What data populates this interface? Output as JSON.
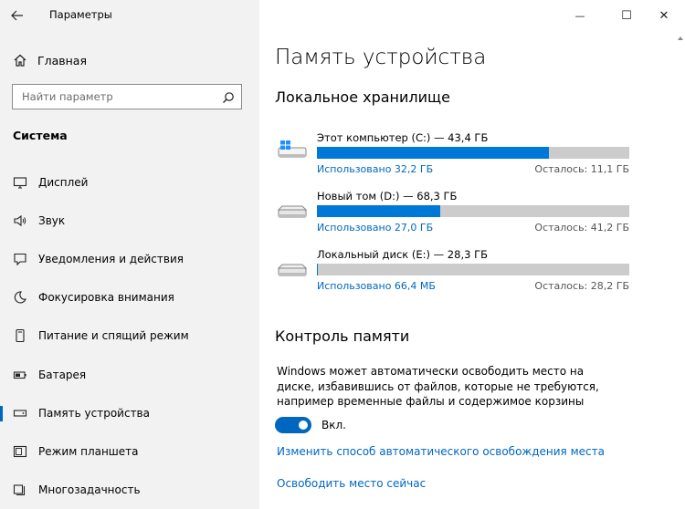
{
  "window": {
    "title": "Параметры",
    "minimize_glyph": "—",
    "maximize_glyph": "☐",
    "close_glyph": "✕"
  },
  "sidebar": {
    "home_label": "Главная",
    "search_placeholder": "Найти параметр",
    "section_title": "Система",
    "items": [
      {
        "label": "Дисплей",
        "icon": "monitor-icon"
      },
      {
        "label": "Звук",
        "icon": "speaker-icon"
      },
      {
        "label": "Уведомления и действия",
        "icon": "notification-icon"
      },
      {
        "label": "Фокусировка внимания",
        "icon": "moon-icon"
      },
      {
        "label": "Питание и спящий режим",
        "icon": "power-icon"
      },
      {
        "label": "Батарея",
        "icon": "battery-icon"
      },
      {
        "label": "Память устройства",
        "icon": "storage-icon",
        "active": true
      },
      {
        "label": "Режим планшета",
        "icon": "tablet-icon"
      },
      {
        "label": "Многозадачность",
        "icon": "multitask-icon"
      }
    ]
  },
  "main": {
    "title": "Память устройства",
    "local_storage_heading": "Локальное хранилище",
    "drives": [
      {
        "name": "Этот компьютер (C:) — 43,4 ГБ",
        "used": "Использовано 32,2 ГБ",
        "free": "Осталось: 11,1 ГБ",
        "used_fraction": 0.742
      },
      {
        "name": "Новый том (D:) — 68,3 ГБ",
        "used": "Использовано 27,0 ГБ",
        "free": "Осталось: 41,2 ГБ",
        "used_fraction": 0.395
      },
      {
        "name": "Локальный диск (E:) — 28,3 ГБ",
        "used": "Использовано 66,4 МБ",
        "free": "Осталось: 28,2 ГБ",
        "used_fraction": 0.002
      }
    ],
    "storage_sense_heading": "Контроль памяти",
    "storage_sense_desc": "Windows может автоматически освободить место на диске, избавившись от файлов, которые не требуются, например временные файлы и содержимое корзины",
    "toggle_label": "Вкл.",
    "link_change": "Изменить способ автоматического освобождения места",
    "link_free_now": "Освободить место сейчас"
  },
  "colors": {
    "accent": "#0078d7",
    "link": "#0067c0",
    "sidebar_bg": "#f2f2f2",
    "bar_bg": "#cccccc"
  }
}
